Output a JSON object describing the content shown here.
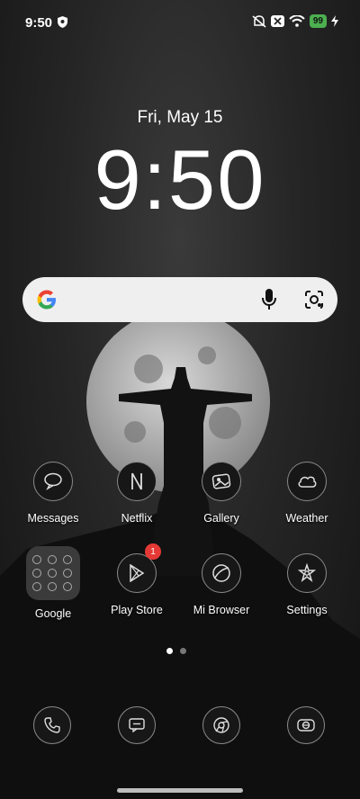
{
  "status_bar": {
    "time": "9:50",
    "battery_level": "99",
    "icons": [
      "shield-icon",
      "mute-icon",
      "notification-x-icon",
      "wifi-icon",
      "battery-icon",
      "charging-icon"
    ]
  },
  "lockscreen": {
    "date": "Fri, May 15",
    "clock": "9:50"
  },
  "search_widget": {
    "icons": [
      "google-logo",
      "mic-icon",
      "lens-icon"
    ]
  },
  "apps_row1": [
    {
      "label": "Messages",
      "icon": "messages-icon"
    },
    {
      "label": "Netflix",
      "icon": "netflix-icon"
    },
    {
      "label": "Gallery",
      "icon": "gallery-icon"
    },
    {
      "label": "Weather",
      "icon": "weather-icon"
    }
  ],
  "apps_row2": [
    {
      "label": "Google",
      "icon": "folder-icon"
    },
    {
      "label": "Play Store",
      "icon": "play-store-icon",
      "badge": "1"
    },
    {
      "label": "Mi Browser",
      "icon": "browser-icon"
    },
    {
      "label": "Settings",
      "icon": "settings-icon"
    }
  ],
  "page_indicator": {
    "pages": 2,
    "current": 1
  },
  "dock": [
    "phone-icon",
    "chat-icon",
    "chrome-icon",
    "camera-icon"
  ],
  "colors": {
    "battery": "#4caf50",
    "badge": "#e53935"
  }
}
